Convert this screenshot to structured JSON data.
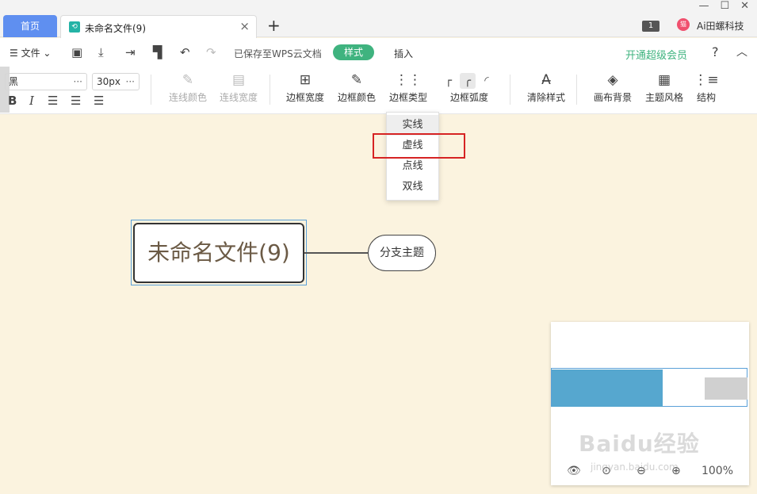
{
  "tabs": {
    "home": "首页",
    "document": "未命名文件(9)",
    "new_tab_icon": "+",
    "close_icon": "×"
  },
  "window": {
    "badge": "1",
    "user_name": "Ai田螺科技",
    "avatar_text": "猫"
  },
  "menu": {
    "file": "文件",
    "saved_status": "已保存至WPS云文档",
    "style_tab": "样式",
    "insert_tab": "插入",
    "vip": "开通超级会员",
    "help": "?"
  },
  "toolbar": {
    "font_family": "黑",
    "font_size": "30px",
    "tools": [
      {
        "label": "连线颜色",
        "disabled": true
      },
      {
        "label": "连线宽度",
        "disabled": true
      },
      {
        "label": "边框宽度",
        "disabled": false
      },
      {
        "label": "边框颜色",
        "disabled": false
      },
      {
        "label": "边框类型",
        "disabled": false
      },
      {
        "label": "边框弧度",
        "disabled": false
      },
      {
        "label": "清除样式",
        "disabled": false
      },
      {
        "label": "画布背景",
        "disabled": false
      },
      {
        "label": "主题风格",
        "disabled": false
      },
      {
        "label": "结构",
        "disabled": false
      }
    ]
  },
  "dropdown": {
    "options": [
      "实线",
      "虚线",
      "点线",
      "双线"
    ],
    "highlighted": "虚线"
  },
  "canvas": {
    "root_topic": "未命名文件(9)",
    "branch_topic": "分支主题",
    "background_color": "#fbf3df"
  },
  "minimap": {
    "zoom": "100%"
  },
  "watermark": {
    "main": "Baidu经验",
    "sub": "jingyan.baidu.com"
  },
  "colors": {
    "accent_green": "#3fb37f",
    "home_tab_blue": "#5f8ff0",
    "highlight_red": "#d62323",
    "minimap_root": "#56a7cf"
  }
}
